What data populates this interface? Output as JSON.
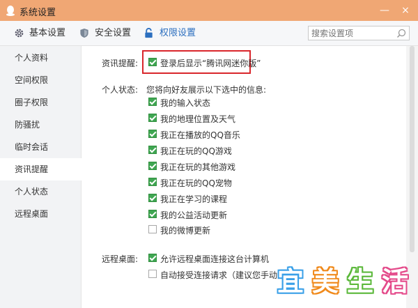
{
  "window": {
    "title": "系统设置",
    "minimize": "—",
    "close": "×"
  },
  "tabs": [
    {
      "label": "基本设置"
    },
    {
      "label": "安全设置"
    },
    {
      "label": "权限设置"
    }
  ],
  "search": {
    "placeholder": "搜索设置项"
  },
  "sidebar": {
    "items": [
      {
        "label": "个人资料"
      },
      {
        "label": "空间权限"
      },
      {
        "label": "圈子权限"
      },
      {
        "label": "防骚扰"
      },
      {
        "label": "临时会话"
      },
      {
        "label": "资讯提醒"
      },
      {
        "label": "个人状态"
      },
      {
        "label": "远程桌面"
      }
    ]
  },
  "news": {
    "label": "资讯提醒:",
    "option": "登录后显示“腾讯网迷你版”",
    "checked": true
  },
  "status": {
    "label": "个人状态:",
    "desc": "您将向好友展示以下选中的信息:",
    "options": [
      {
        "text": "我的输入状态",
        "checked": true
      },
      {
        "text": "我的地理位置及天气",
        "checked": true
      },
      {
        "text": "我正在播放的QQ音乐",
        "checked": true
      },
      {
        "text": "我正在玩的QQ游戏",
        "checked": true
      },
      {
        "text": "我正在玩的其他游戏",
        "checked": true
      },
      {
        "text": "我正在玩的QQ宠物",
        "checked": true
      },
      {
        "text": "我正在学习的课程",
        "checked": true
      },
      {
        "text": "我的公益活动更新",
        "checked": true
      },
      {
        "text": "我的微博更新",
        "checked": false
      }
    ]
  },
  "remote": {
    "label": "远程桌面:",
    "options": [
      {
        "text": "允许远程桌面连接这台计算机",
        "checked": true
      },
      {
        "text": "自动接受连接请求（建议您手动关闭",
        "checked": false
      }
    ]
  },
  "watermark": {
    "chars": [
      "宜",
      "美",
      "生",
      "活"
    ],
    "colors": [
      "#3aa0e8",
      "#f08a1c",
      "#5bb83a",
      "#e44a8a"
    ]
  }
}
